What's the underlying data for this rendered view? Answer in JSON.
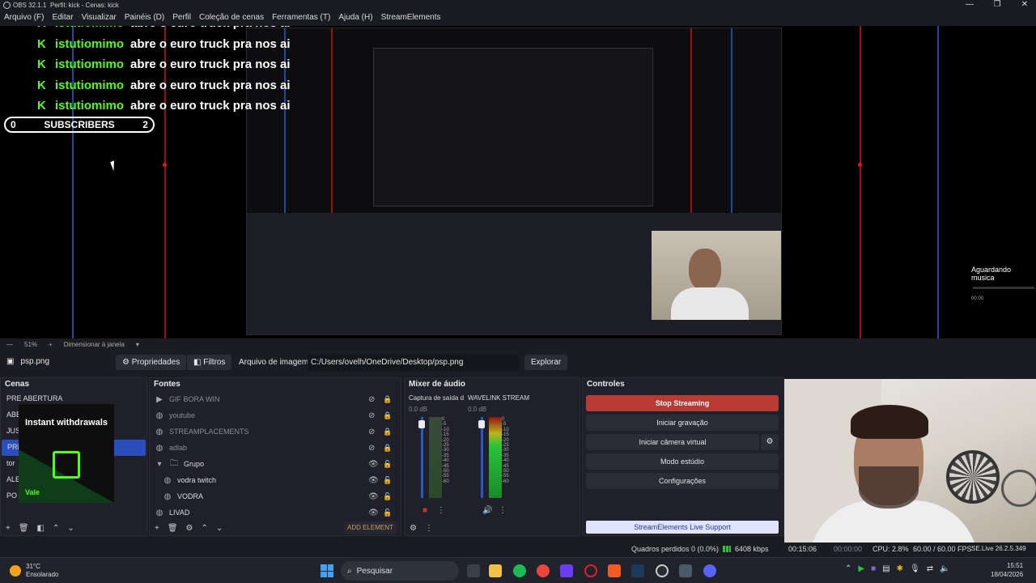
{
  "window": {
    "app_title": "OBS 32.1.1",
    "profile_title": "Perfil: kick - Cenas: kick",
    "controls": [
      "—",
      "❐",
      "✕"
    ]
  },
  "menu": [
    "Arquivo (F)",
    "Editar",
    "Visualizar",
    "Painéis (D)",
    "Perfil",
    "Coleção de cenas",
    "Ferramentas (T)",
    "Ajuda (H)",
    "StreamElements"
  ],
  "overlay": {
    "chat_user": "istutiomimo",
    "chat_message": "abre o euro truck pra nos ai",
    "chat_lines": 5,
    "subs_left": "0",
    "subs_label": "SUBSCRIBERS",
    "subs_right": "2",
    "waiting_music": "Aguardando musica",
    "music_time": "00:00"
  },
  "preview_status": {
    "zoom": "51%",
    "resize": "Dimensionar à janela"
  },
  "source_toolbar": {
    "source_name": "psp.png",
    "properties": "Propriedades",
    "filters": "Filtros",
    "file_label": "Arquivo de imagem",
    "file_path": "C:/Users/ovelh/OneDrive/Desktop/psp.png",
    "browse": "Explorar"
  },
  "scenes": {
    "title": "Cenas",
    "items": [
      "PRE ABERTURA",
      "ABE",
      "JUS",
      "PRI",
      "tor",
      "ALE",
      "PO"
    ],
    "selected_index": 3,
    "thumb_text": "Instant withdrawals",
    "thumb_badge": "Vale"
  },
  "sources": {
    "title": "Fontes",
    "items": [
      {
        "label": "GIF BORA WIN",
        "icon": "play-icon",
        "visible": false
      },
      {
        "label": "youtube",
        "icon": "globe-icon",
        "visible": false
      },
      {
        "label": "STREAMPLACEMENTS",
        "icon": "globe-icon",
        "visible": false
      },
      {
        "label": "adlab",
        "icon": "globe-icon",
        "visible": false
      },
      {
        "label": "Grupo",
        "icon": "folder-icon",
        "visible": true
      },
      {
        "label": "vodra twitch",
        "icon": "globe-icon",
        "visible": true
      },
      {
        "label": "VODRA",
        "icon": "globe-icon",
        "visible": true
      },
      {
        "label": "LIVAD",
        "icon": "globe-icon",
        "visible": true
      }
    ],
    "add_element": "ADD ELEMENT"
  },
  "mixer": {
    "title": "Mixer de áudio",
    "channels": [
      {
        "name": "Captura de saída d",
        "db": "0.0 dB"
      },
      {
        "name": "WAVELINK STREAM",
        "db": "0.0 dB"
      }
    ],
    "scale": [
      "0",
      "-5",
      "-10",
      "-15",
      "-20",
      "-25",
      "-30",
      "-35",
      "-40",
      "-45",
      "-50",
      "-55",
      "-60"
    ]
  },
  "controls": {
    "title": "Controles",
    "stop_streaming": "Stop Streaming",
    "start_recording": "Iniciar gravação",
    "virtual_cam": "Iniciar câmera virtual",
    "studio_mode": "Modo estúdio",
    "settings": "Configurações",
    "se_support": "StreamElements Live Support"
  },
  "status": {
    "dropped": "Quadros perdidos 0 (0.0%)",
    "kbps": "6408 kbps",
    "live_time": "00:15:06",
    "rec_time": "00:00:00",
    "cpu": "CPU: 2.8%",
    "fps": "60.00 / 60.00 FPS",
    "se_version": "SE.Live 26.2.5.349"
  },
  "taskbar": {
    "temp": "31°C",
    "weather": "Ensolarado",
    "search": "Pesquisar",
    "time": "15:51",
    "date": "18/04/2026"
  },
  "colors": {
    "accent_green": "#53fc18",
    "stop_red": "#b83a33",
    "scene_selected": "#2c4dbd"
  }
}
